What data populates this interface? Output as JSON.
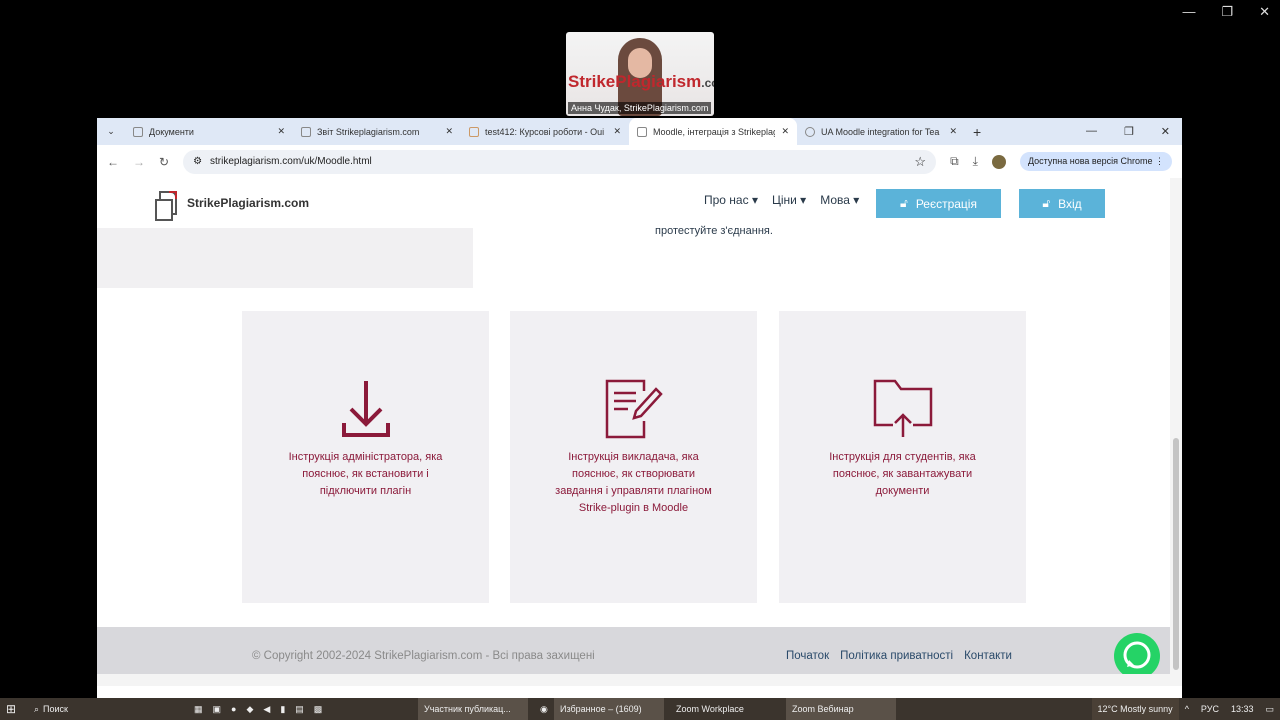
{
  "video": {
    "logo": "StrikePlagiarism",
    "logo_suffix": ".com",
    "name": "Анна Чудак, StrikePlagiarism.com"
  },
  "tabs": [
    {
      "label": "Документи"
    },
    {
      "label": "Звіт Strikeplagiarism.com"
    },
    {
      "label": "test412: Курсові роботи - Oui"
    },
    {
      "label": "Moodle, інтеграція з Strikeplag"
    },
    {
      "label": "UA Moodle integration for Tea"
    }
  ],
  "toolbar": {
    "url": "strikeplagiarism.com/uk/Moodle.html",
    "update": "Доступна нова версія Chrome"
  },
  "site": {
    "brand": "StrikePlagiarism.com",
    "nav": [
      "Про нас",
      "Ціни",
      "Мова"
    ],
    "register": "Реєстрація",
    "login": "Вхід",
    "test_text": "протестуйте з'єднання."
  },
  "cards": [
    {
      "icon": "download-icon",
      "text": "Інструкція адміністратора, яка пояснює, як встановити і підключити плагін"
    },
    {
      "icon": "edit-document-icon",
      "text": "Інструкція викладача, яка пояснює, як створювати завдання і управляти плагіном Strike-plugin в Moodle"
    },
    {
      "icon": "folder-upload-icon",
      "text": "Інструкція для студентів, яка пояснює, як завантажувати документи"
    }
  ],
  "footer": {
    "copyright": "© Copyright 2002-2024 StrikePlagiarism.com - Всі права захищені",
    "links": [
      "Початок",
      "Політика приватності",
      "Контакти"
    ]
  },
  "taskbar": {
    "search": "Поиск",
    "apps": [
      "Участник публикац...",
      "Избранное – (1609)",
      "Zoom Workplace",
      "Zoom Вебинар"
    ],
    "weather": "12°C  Mostly sunny",
    "lang": "РУС",
    "time": "13:33"
  },
  "colors": {
    "accent": "#8b1a3a",
    "button": "#5bb3d9"
  }
}
